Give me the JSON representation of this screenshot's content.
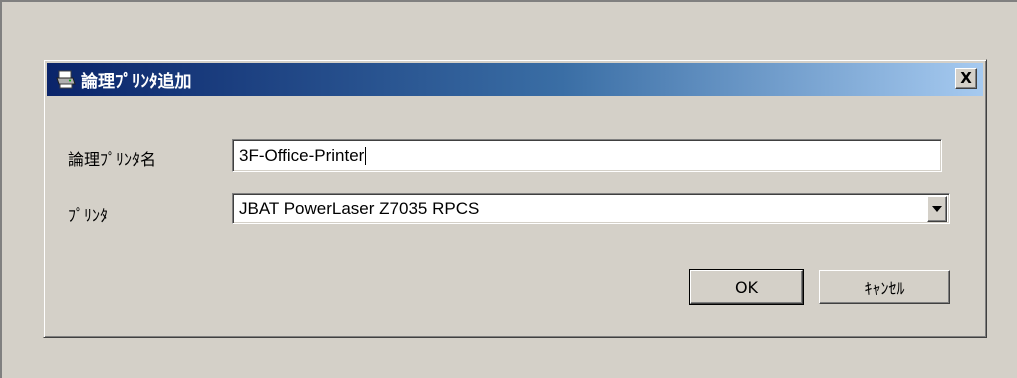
{
  "dialog": {
    "title": "論理ﾌﾟﾘﾝﾀ追加",
    "icon": "printer-icon",
    "close_label": "X"
  },
  "form": {
    "logical_name_label": "論理ﾌﾟﾘﾝﾀ名",
    "logical_name_value": "3F-Office-Printer",
    "printer_label": "ﾌﾟﾘﾝﾀ",
    "printer_value": "JBAT PowerLaser Z7035 RPCS"
  },
  "buttons": {
    "ok_label": "OK",
    "cancel_label": "ｷｬﾝｾﾙ"
  },
  "colors": {
    "face": "#d4d0c8",
    "title_start": "#0a246a",
    "title_end": "#a6caf0"
  }
}
